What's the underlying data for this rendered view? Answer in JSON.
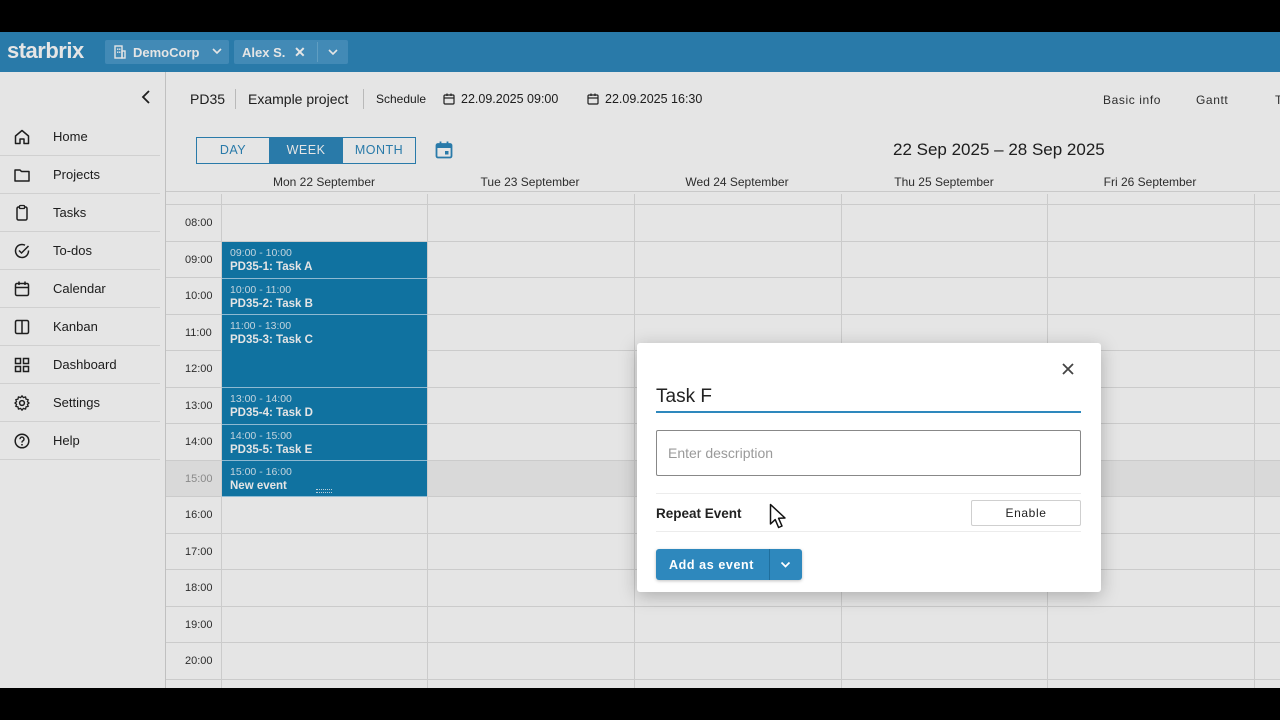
{
  "topbar": {
    "logo": "starbrix",
    "org": "DemoCorp",
    "user": "Alex S."
  },
  "sidebar": {
    "items": [
      {
        "label": "Home",
        "icon": "home-icon"
      },
      {
        "label": "Projects",
        "icon": "folder-icon"
      },
      {
        "label": "Tasks",
        "icon": "clipboard-icon"
      },
      {
        "label": "To-dos",
        "icon": "check-circle-icon"
      },
      {
        "label": "Calendar",
        "icon": "calendar-icon"
      },
      {
        "label": "Kanban",
        "icon": "kanban-icon"
      },
      {
        "label": "Dashboard",
        "icon": "dashboard-icon"
      },
      {
        "label": "Settings",
        "icon": "gear-icon"
      },
      {
        "label": "Help",
        "icon": "help-icon"
      }
    ]
  },
  "project": {
    "code": "PD35",
    "name": "Example project",
    "schedule_label": "Schedule",
    "start": "22.09.2025 09:00",
    "end": "22.09.2025 16:30",
    "tabs": [
      "Basic info",
      "Gantt",
      "T"
    ]
  },
  "calendar": {
    "views": [
      "DAY",
      "WEEK",
      "MONTH"
    ],
    "active_view": "WEEK",
    "range": "22 Sep 2025 – 28 Sep 2025",
    "days": [
      "Mon 22 September",
      "Tue 23 September",
      "Wed 24 September",
      "Thu 25 September",
      "Fri 26 September"
    ],
    "hours": [
      "08:00",
      "09:00",
      "10:00",
      "11:00",
      "12:00",
      "13:00",
      "14:00",
      "15:00",
      "16:00",
      "17:00",
      "18:00",
      "19:00",
      "20:00"
    ],
    "events": [
      {
        "time": "09:00 - 10:00",
        "title": "PD35-1: Task A"
      },
      {
        "time": "10:00 - 11:00",
        "title": "PD35-2: Task B"
      },
      {
        "time": "11:00 - 13:00",
        "title": "PD35-3: Task C"
      },
      {
        "time": "13:00 - 14:00",
        "title": "PD35-4: Task D"
      },
      {
        "time": "14:00 - 15:00",
        "title": "PD35-5: Task E"
      },
      {
        "time": "15:00 - 16:00",
        "title": "New event"
      }
    ]
  },
  "dialog": {
    "title_value": "Task F",
    "description_placeholder": "Enter description",
    "repeat_label": "Repeat Event",
    "enable_label": "Enable",
    "add_label": "Add as event"
  },
  "colors": {
    "brand": "#2e88bd",
    "event": "#127fb3"
  }
}
